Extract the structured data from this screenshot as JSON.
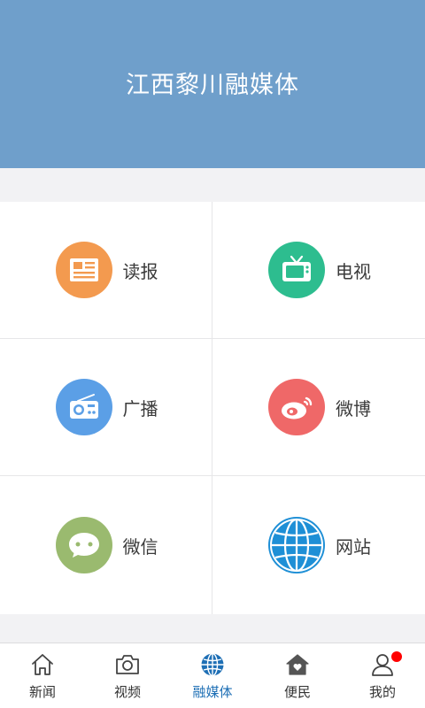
{
  "header": {
    "title": "江西黎川融媒体"
  },
  "grid": {
    "items": [
      {
        "label": "读报",
        "icon": "newspaper-icon",
        "color": "#f39a4f"
      },
      {
        "label": "电视",
        "icon": "tv-icon",
        "color": "#2dbd8f"
      },
      {
        "label": "广播",
        "icon": "radio-icon",
        "color": "#5b9fe6"
      },
      {
        "label": "微博",
        "icon": "weibo-icon",
        "color": "#ef6868"
      },
      {
        "label": "微信",
        "icon": "wechat-icon",
        "color": "#9aba6f"
      },
      {
        "label": "网站",
        "icon": "globe-icon",
        "color": "#1e8fd6"
      }
    ]
  },
  "tabbar": {
    "active": "融媒体",
    "active_color": "#1e6fb5",
    "badge_color": "#ff0000",
    "items": [
      {
        "label": "新闻",
        "icon": "home-icon"
      },
      {
        "label": "视频",
        "icon": "camera-icon"
      },
      {
        "label": "融媒体",
        "icon": "globe-icon"
      },
      {
        "label": "便民",
        "icon": "house-heart-icon"
      },
      {
        "label": "我的",
        "icon": "user-icon"
      }
    ]
  }
}
